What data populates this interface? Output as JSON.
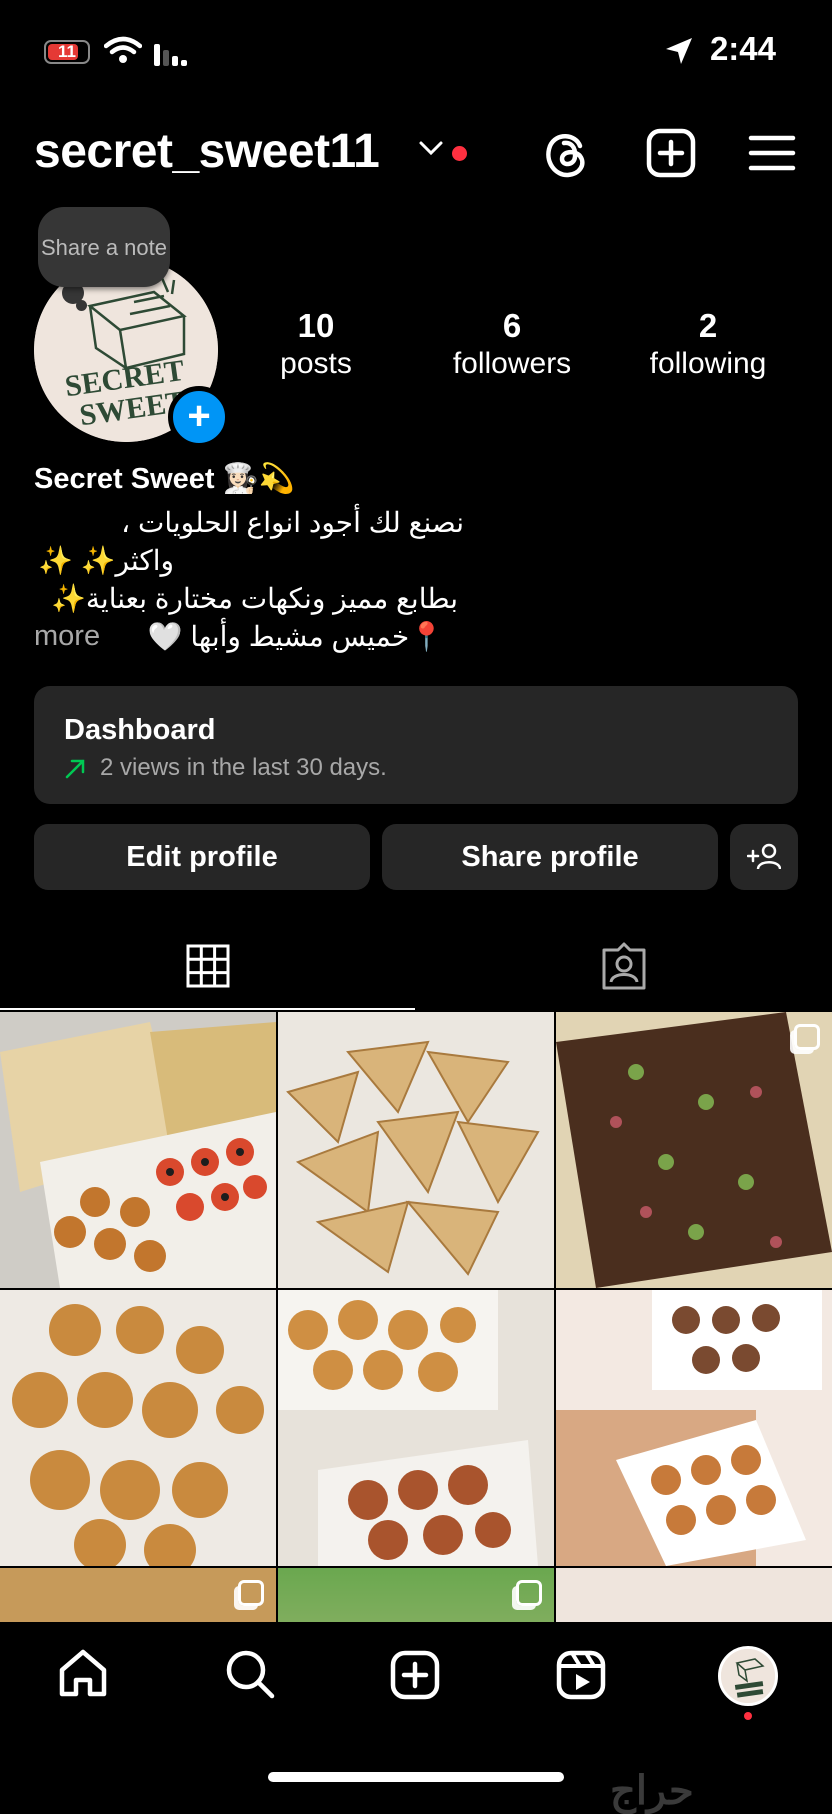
{
  "status_bar": {
    "battery": "11",
    "time": "2:44"
  },
  "header": {
    "username": "secret_sweet11"
  },
  "profile": {
    "note_text": "Share a note",
    "logo_text": [
      "SECRET",
      "SWEET"
    ],
    "stats": [
      {
        "value": "10",
        "label": "posts"
      },
      {
        "value": "6",
        "label": "followers"
      },
      {
        "value": "2",
        "label": "following"
      }
    ],
    "name": "Secret Sweet 👩🏻‍🍳💫",
    "bio_lines": [
      "نصنع لك أجود انواع الحلويات ،",
      "واكثر✨ ✨",
      "بطابع مميز ونكهات مختارة بعناية✨",
      "📍خميس مشيط وأبها 🤍"
    ],
    "more": "more"
  },
  "dashboard": {
    "title": "Dashboard",
    "subtitle": "2 views in the last 30 days.",
    "trend_color": "#00c853"
  },
  "buttons": {
    "edit": "Edit profile",
    "share": "Share profile"
  },
  "nav": {
    "items": [
      "home-icon",
      "search-icon",
      "create-icon",
      "reels-icon",
      "profile-avatar"
    ]
  },
  "watermark": "حراج",
  "colors": {
    "accent": "#0095f6",
    "notification": "#ff3040",
    "surface": "#262626"
  }
}
